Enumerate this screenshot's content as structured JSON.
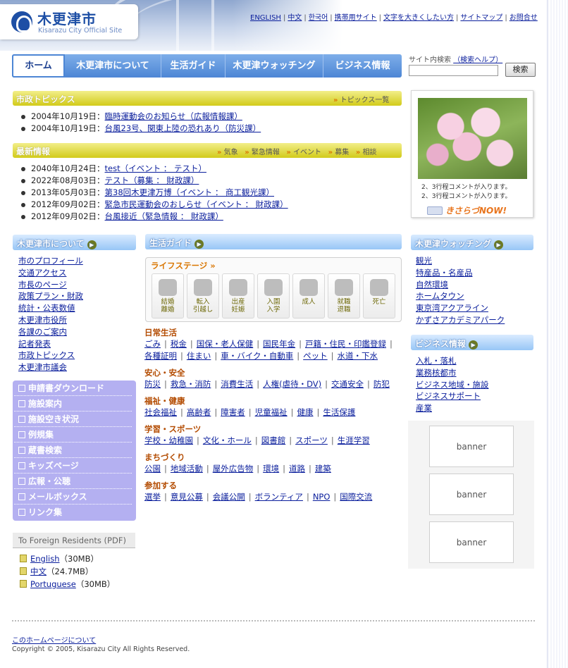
{
  "header": {
    "city_name": "木更津市",
    "city_sub": "Kisarazu City Official Site",
    "util_links": [
      "ENGLISH",
      "中文",
      "한국어",
      "携帯用サイト",
      "文字を大きくしたい方",
      "サイトマップ",
      "お問合せ"
    ]
  },
  "nav": {
    "items": [
      "ホーム",
      "木更津市について",
      "生活ガイド",
      "木更津ウォッチング",
      "ビジネス情報"
    ]
  },
  "search": {
    "label": "サイト内検索",
    "help": "（検索ヘルプ）",
    "button": "検索",
    "placeholder": ""
  },
  "topics": {
    "title": "市政トピックス",
    "list_link": "トピックス一覧",
    "items": [
      {
        "date": "2004年10月19日：",
        "text": "臨時運動会のお知らせ（広報情報課）"
      },
      {
        "date": "2004年10月19日：",
        "text": "台風23号、関東上陸の恐れあり（防災課）"
      }
    ]
  },
  "latest": {
    "title": "最新情報",
    "filters": [
      "気象",
      "緊急情報",
      "イベント",
      "募集",
      "相談"
    ],
    "items": [
      {
        "date": "2040年10月24日：",
        "text": "test（イベント ： テスト）"
      },
      {
        "date": "2022年08月03日：",
        "text": "テスト（募集 ： 財政課）"
      },
      {
        "date": "2013年05月03日：",
        "text": "第38回木更津万博（イベント ： 商工観光課）"
      },
      {
        "date": "2012年09月02日：",
        "text": "緊急市民運動会のおしらせ（イベント ： 財政課）"
      },
      {
        "date": "2012年09月02日：",
        "text": "台風接近（緊急情報 ： 財政課）"
      }
    ]
  },
  "photo": {
    "caption1": "2、3行程コメントが入ります。",
    "caption2": "2、3行程コメントが入ります。",
    "tag": "きさらづNOW!"
  },
  "about": {
    "title": "木更津市について",
    "links": [
      "市のプロフィール",
      "交通アクセス",
      "市長のページ",
      "政策プラン・財政",
      "統計・公表数値",
      "木更津市役所",
      "各課のご案内",
      "記者発表",
      "市政トピックス",
      "木更津市議会"
    ]
  },
  "side_menu": {
    "items": [
      "申請書ダウンロード",
      "施設案内",
      "施設空き状況",
      "例規集",
      "蔵書検索",
      "キッズページ",
      "広報・公聴",
      "メールボックス",
      "リンク集"
    ]
  },
  "foreign": {
    "title": "To Foreign Residents (PDF)",
    "items": [
      {
        "name": "English",
        "size": "（30MB）"
      },
      {
        "name": "中文",
        "size": "（24.7MB）"
      },
      {
        "name": "Portuguese",
        "size": "（30MB）"
      }
    ]
  },
  "life_guide": {
    "title": "生活ガイド",
    "stage_title": "ライフステージ",
    "stages": [
      "結婚\n離婚",
      "転入\n引越し",
      "出産\n妊娠",
      "入園\n入学",
      "成人",
      "就職\n退職",
      "死亡"
    ],
    "categories": [
      {
        "title": "日常生活",
        "lines": [
          [
            "ごみ",
            "税金",
            "国保・老人保健",
            "国民年金",
            "戸籍・住民・印鑑登録",
            ""
          ],
          [
            "各種証明",
            "住まい",
            "車・バイク・自動車",
            "ペット",
            "水道・下水"
          ]
        ]
      },
      {
        "title": "安心・安全",
        "lines": [
          [
            "防災",
            "救急・消防",
            "消費生活",
            "人権(虐待・DV)",
            "交通安全",
            "防犯"
          ]
        ]
      },
      {
        "title": "福祉・健康",
        "lines": [
          [
            "社会福祉",
            "高齢者",
            "障害者",
            "児童福祉",
            "健康",
            "生活保護"
          ]
        ]
      },
      {
        "title": "学習・スポーツ",
        "lines": [
          [
            "学校・幼稚園",
            "文化・ホール",
            "図書館",
            "スポーツ",
            "生涯学習"
          ]
        ]
      },
      {
        "title": "まちづくり",
        "lines": [
          [
            "公園",
            "地域活動",
            "屋外広告物",
            "環境",
            "道路",
            "建築"
          ]
        ]
      },
      {
        "title": "参加する",
        "lines": [
          [
            "選挙",
            "意見公募",
            "会議公開",
            "ボランティア",
            "NPO",
            "国際交流"
          ]
        ]
      }
    ]
  },
  "watching": {
    "title": "木更津ウォッチング",
    "links": [
      "観光",
      "特産品・名産品",
      "自然環境",
      "ホームタウン",
      "東京湾アクアライン",
      "かずさアカデミアパーク"
    ]
  },
  "business": {
    "title": "ビジネス情報",
    "links": [
      "入札・落札",
      "業務核都市",
      "ビジネス地域・施設",
      "ビジネスサポート",
      "産業"
    ]
  },
  "banners": [
    "banner",
    "banner",
    "banner"
  ],
  "footer": {
    "about_link": "このホームページについて",
    "copyright": "Copyright © 2005, Kisarazu City All Rights Reserved."
  }
}
